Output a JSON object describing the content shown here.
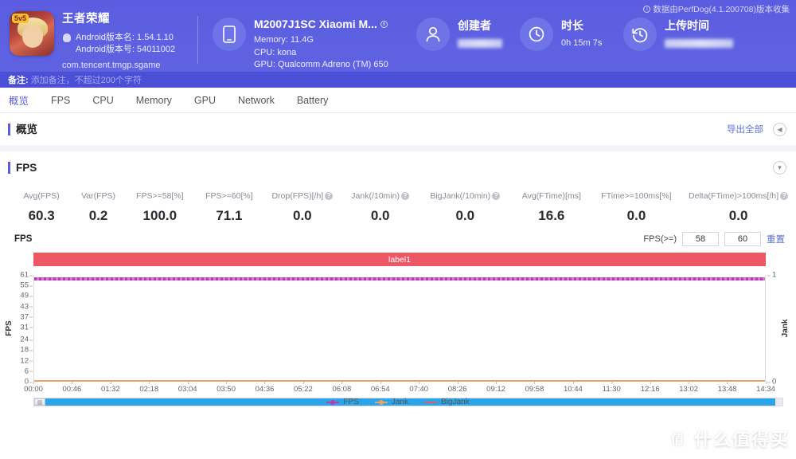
{
  "header": {
    "app": {
      "name": "王者荣耀",
      "icon_badge": "5v5",
      "version_name": "Android版本名: 1.54.1.10",
      "version_code": "Android版本号: 54011002",
      "package": "com.tencent.tmgp.sgame"
    },
    "device": {
      "title": "M2007J1SC Xiaomi M...",
      "memory": "Memory: 11.4G",
      "cpu": "CPU: kona",
      "gpu": "GPU: Qualcomm Adreno (TM) 650",
      "icon": "phone-icon"
    },
    "creator": {
      "title": "创建者",
      "value": "",
      "icon": "user-icon"
    },
    "duration": {
      "title": "时长",
      "value": "0h 15m 7s",
      "icon": "clock-icon"
    },
    "upload": {
      "title": "上传时间",
      "value": "",
      "icon": "history-icon"
    },
    "collected_by": "数据由PerfDog(4.1.200708)版本收集",
    "note_label": "备注:",
    "note_placeholder": "添加备注，不超过200个字符"
  },
  "tabs": [
    {
      "label": "概览",
      "active": true
    },
    {
      "label": "FPS",
      "active": false
    },
    {
      "label": "CPU",
      "active": false
    },
    {
      "label": "Memory",
      "active": false
    },
    {
      "label": "GPU",
      "active": false
    },
    {
      "label": "Network",
      "active": false
    },
    {
      "label": "Battery",
      "active": false
    }
  ],
  "overview_panel": {
    "title": "概览",
    "export_label": "导出全部",
    "collapse_icon": "chevron-left-icon"
  },
  "fps_panel": {
    "title": "FPS",
    "expand_icon": "chevron-down-icon",
    "metrics": [
      {
        "label": "Avg(FPS)",
        "value": "60.3",
        "help": false
      },
      {
        "label": "Var(FPS)",
        "value": "0.2",
        "help": false
      },
      {
        "label": "FPS>=58[%]",
        "value": "100.0",
        "help": false
      },
      {
        "label": "FPS>=60[%]",
        "value": "71.1",
        "help": false
      },
      {
        "label": "Drop(FPS)[/h]",
        "value": "0.0",
        "help": true
      },
      {
        "label": "Jank(/10min)",
        "value": "0.0",
        "help": true
      },
      {
        "label": "BigJank(/10min)",
        "value": "0.0",
        "help": true
      },
      {
        "label": "Avg(FTime)[ms]",
        "value": "16.6",
        "help": false
      },
      {
        "label": "FTime>=100ms[%]",
        "value": "0.0",
        "help": false
      },
      {
        "label": "Delta(FTime)>100ms[/h]",
        "value": "0.0",
        "help": true
      }
    ],
    "chart_axis_label": "FPS",
    "threshold_label": "FPS(>=)",
    "threshold_low": "58",
    "threshold_high": "60",
    "reset_label": "重置",
    "series_band_label": "label1"
  },
  "chart_data": {
    "type": "line",
    "title": "FPS",
    "xlabel": "",
    "ylabel": "FPS",
    "y2label": "Jank",
    "grid": false,
    "legend_position": "bottom",
    "ylim": [
      0,
      61
    ],
    "y2lim": [
      0,
      1
    ],
    "yticks": [
      61,
      55,
      49,
      43,
      37,
      31,
      24,
      18,
      12,
      6,
      0
    ],
    "y2ticks": [
      1,
      0
    ],
    "xticks": [
      "00:00",
      "00:46",
      "01:32",
      "02:18",
      "03:04",
      "03:50",
      "04:36",
      "05:22",
      "06:08",
      "06:54",
      "07:40",
      "08:26",
      "09:12",
      "09:58",
      "10:44",
      "11:30",
      "12:16",
      "13:02",
      "13:48",
      "14:34"
    ],
    "series": [
      {
        "name": "FPS",
        "color": "#b23fb0",
        "axis": "left",
        "constant_value": 60,
        "note": "flat dense line at ~60 fps across entire duration"
      },
      {
        "name": "Jank",
        "color": "#e8a36a",
        "axis": "right",
        "constant_value": 0
      },
      {
        "name": "BigJank",
        "color": "#d9606f",
        "axis": "right",
        "constant_value": 0
      }
    ],
    "band": {
      "label": "label1",
      "color": "#ee5765",
      "start": "00:00",
      "end": "15:07"
    }
  },
  "scrollbar": {
    "thumb_percent": 99
  },
  "watermark": {
    "mark": "值",
    "text": "什么值得买"
  },
  "colors": {
    "brand": "#5b5ce0",
    "accent_link": "#5b6fd0",
    "band": "#ee5765",
    "fps_line": "#b23fb0",
    "jank_line": "#e8a36a",
    "bigjank_line": "#d9606f",
    "scroll_thumb": "#2ca5e8"
  }
}
